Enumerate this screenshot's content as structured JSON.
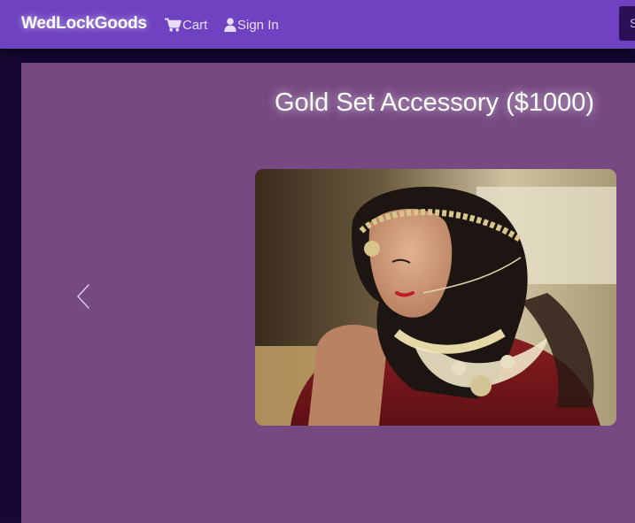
{
  "navbar": {
    "brand": "WedLockGoods",
    "cart_label": "Cart",
    "cart_icon": "cart-icon",
    "signin_label": "Sign In",
    "signin_icon": "user-icon",
    "search_label": "S",
    "background_color": "#6f42c1"
  },
  "product": {
    "title": "Gold Set Accessory ($1000)",
    "image_description_icon": "product-photo",
    "card_color": "#764983"
  },
  "carousel": {
    "prev_icon": "chevron-left-icon"
  }
}
